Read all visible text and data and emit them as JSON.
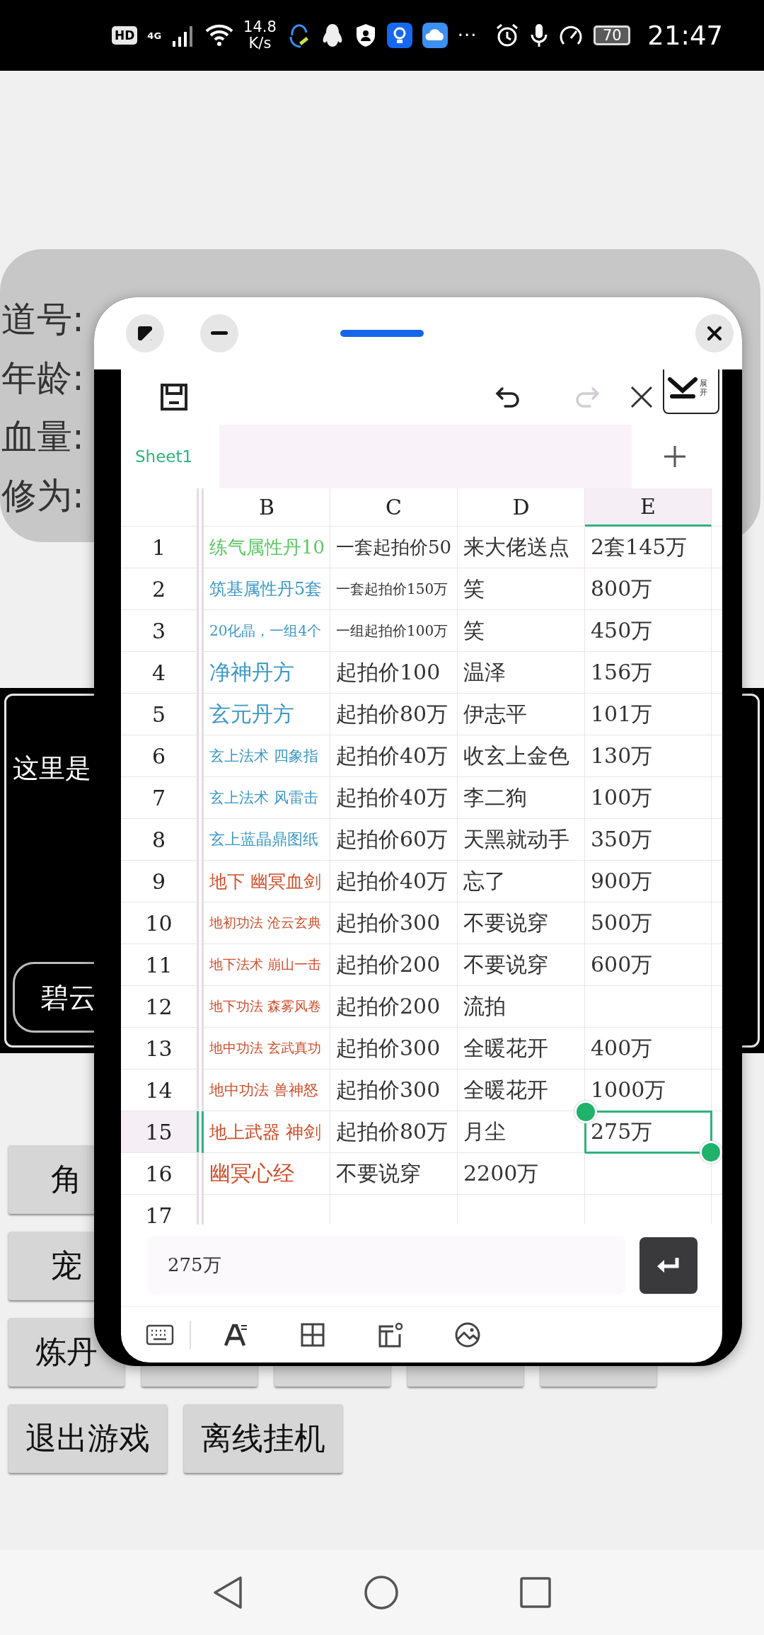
{
  "status_bar": {
    "hd_badge": "HD",
    "network_type": "4G",
    "speed_value": "14.8",
    "speed_unit": "K/s",
    "more": "···",
    "battery": "70",
    "time": "21:47"
  },
  "profile_card": {
    "labels": [
      "道号:",
      "年龄:",
      "血量:",
      "修为:"
    ]
  },
  "message_panel": {
    "text": "这里是",
    "button": "碧云"
  },
  "menu_rows": [
    [
      {
        "kind": "label",
        "label": "角"
      }
    ],
    [
      {
        "kind": "label",
        "label": "宠"
      }
    ],
    [
      {
        "kind": "label",
        "label": "炼丹"
      },
      {
        "kind": "covered"
      },
      {
        "kind": "covered"
      },
      {
        "kind": "covered"
      },
      {
        "kind": "covered"
      }
    ],
    [
      {
        "kind": "label",
        "label": "退出游戏"
      },
      {
        "kind": "label",
        "label": "离线挂机"
      }
    ]
  ],
  "floating_window": {
    "collapse_label": "展开",
    "sheet_tabs": [
      {
        "label": "Sheet1",
        "selected": true
      }
    ],
    "columns": [
      {
        "label": "B",
        "selected": false
      },
      {
        "label": "C",
        "selected": false
      },
      {
        "label": "D",
        "selected": false
      },
      {
        "label": "E",
        "selected": true
      }
    ],
    "rows": [
      {
        "number": "1",
        "selected": false,
        "color": "#5cc665",
        "cells": [
          "练气属性丹10",
          "一套起拍价50",
          "来大佬送点",
          "2套145万"
        ]
      },
      {
        "number": "2",
        "selected": false,
        "color": "#3b98c4",
        "cells": [
          "筑基属性丹5套",
          "一套起拍价150万",
          "笑",
          "800万"
        ]
      },
      {
        "number": "3",
        "selected": false,
        "color": "#3b98c4",
        "cells": [
          "20化晶，一组4个",
          "一组起拍价100万",
          "笑",
          "450万"
        ]
      },
      {
        "number": "4",
        "selected": false,
        "color": "#3b98c4",
        "cells": [
          "净神丹方",
          "起拍价100",
          "温泽",
          "156万"
        ]
      },
      {
        "number": "5",
        "selected": false,
        "color": "#3b98c4",
        "cells": [
          "玄元丹方",
          "起拍价80万",
          "伊志平",
          "101万"
        ]
      },
      {
        "number": "6",
        "selected": false,
        "color": "#3b98c4",
        "cells": [
          "玄上法术 四象指",
          "起拍价40万",
          "收玄上金色",
          "130万"
        ]
      },
      {
        "number": "7",
        "selected": false,
        "color": "#3b98c4",
        "cells": [
          "玄上法术 风雷击",
          "起拍价40万",
          "李二狗",
          "100万"
        ]
      },
      {
        "number": "8",
        "selected": false,
        "color": "#3b98c4",
        "cells": [
          "玄上蓝晶鼎图纸",
          "起拍价60万",
          "天黑就动手",
          "350万"
        ]
      },
      {
        "number": "9",
        "selected": false,
        "color": "#cf4f2c",
        "cells": [
          "地下 幽冥血剑",
          "起拍价40万",
          "忘了",
          "900万"
        ]
      },
      {
        "number": "10",
        "selected": false,
        "color": "#cf4f2c",
        "cells": [
          "地初功法 沧云玄典",
          "起拍价300",
          "不要说穿",
          "500万"
        ]
      },
      {
        "number": "11",
        "selected": false,
        "color": "#cf4f2c",
        "cells": [
          "地下法术 崩山一击",
          "起拍价200",
          "不要说穿",
          "600万"
        ]
      },
      {
        "number": "12",
        "selected": false,
        "color": "#cf4f2c",
        "cells": [
          "地下功法 森雾风卷",
          "起拍价200",
          "流拍"
        ]
      },
      {
        "number": "13",
        "selected": false,
        "color": "#cf4f2c",
        "cells": [
          "地中功法 玄武真功",
          "起拍价300",
          "全暖花开",
          "400万"
        ]
      },
      {
        "number": "14",
        "selected": false,
        "color": "#cf4f2c",
        "cells": [
          "地中功法 兽神怒",
          "起拍价300",
          "全暖花开",
          "1000万"
        ]
      },
      {
        "number": "15",
        "selected": true,
        "color": "#cf4f2c",
        "cells": [
          "地上武器 神剑",
          "起拍价80万",
          "月尘",
          "275万"
        ]
      },
      {
        "number": "16",
        "selected": false,
        "color": "#cf4f2c",
        "cells": [
          "幽冥心经",
          "不要说穿",
          "2200万"
        ]
      },
      {
        "number": "17",
        "selected": false,
        "cells": []
      }
    ],
    "formula_value": "275万"
  }
}
